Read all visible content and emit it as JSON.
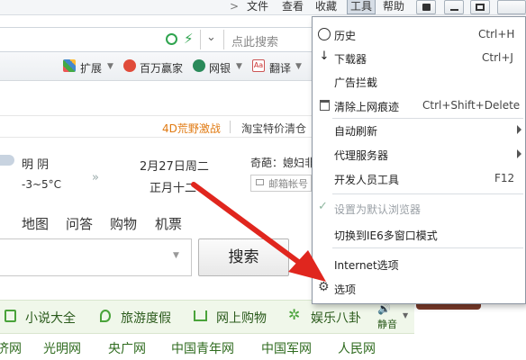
{
  "menubar": {
    "items": [
      "文件",
      "查看",
      "收藏",
      "工具",
      "帮助"
    ],
    "active": "工具"
  },
  "address": {
    "search_placeholder": "点此搜索"
  },
  "toolbar": {
    "items": [
      "扩展",
      "百万赢家",
      "网银",
      "翻译"
    ]
  },
  "promo": {
    "left": "4D荒野激战",
    "right": "淘宝特价清仓"
  },
  "weather": {
    "condition": "明 阴",
    "temp": "-3~5°C",
    "date": "2月27日周二",
    "lunar": "正月十二",
    "news": "奇葩：媳妇非",
    "mail_placeholder": "邮箱帐号"
  },
  "navtabs": [
    "地图",
    "问答",
    "购物",
    "机票"
  ],
  "search": {
    "button": "搜索"
  },
  "categories": [
    "小说大全",
    "旅游度假",
    "网上购物",
    "娱乐八卦"
  ],
  "mute_label": "静音",
  "links": [
    "济网",
    "光明网",
    "央广网",
    "中国青年网",
    "中国军网",
    "人民网"
  ],
  "tools_menu": {
    "items": [
      {
        "label": "历史",
        "shortcut": "Ctrl+H",
        "icon": "clock-icon"
      },
      {
        "label": "下载器",
        "shortcut": "Ctrl+J",
        "icon": "download-icon"
      },
      {
        "label": "广告拦截",
        "shortcut": "",
        "icon": ""
      },
      {
        "label": "清除上网痕迹",
        "shortcut": "Ctrl+Shift+Delete",
        "icon": "trash-icon"
      },
      {
        "label": "自动刷新",
        "shortcut": "",
        "icon": "",
        "submenu": true
      },
      {
        "label": "代理服务器",
        "shortcut": "",
        "icon": "",
        "submenu": true
      },
      {
        "label": "开发人员工具",
        "shortcut": "F12",
        "icon": ""
      },
      {
        "label": "设置为默认浏览器",
        "shortcut": "",
        "icon": "check-icon",
        "disabled": true
      },
      {
        "label": "切换到IE6多窗口模式",
        "shortcut": "",
        "icon": ""
      },
      {
        "label": "Internet选项",
        "shortcut": "",
        "icon": ""
      },
      {
        "label": "选项",
        "shortcut": "",
        "icon": "gear-icon"
      }
    ]
  },
  "colors": {
    "accent_arrow": "#e0261e",
    "category_bg": "#f0f7ea",
    "link_green": "#2f6b1f"
  }
}
